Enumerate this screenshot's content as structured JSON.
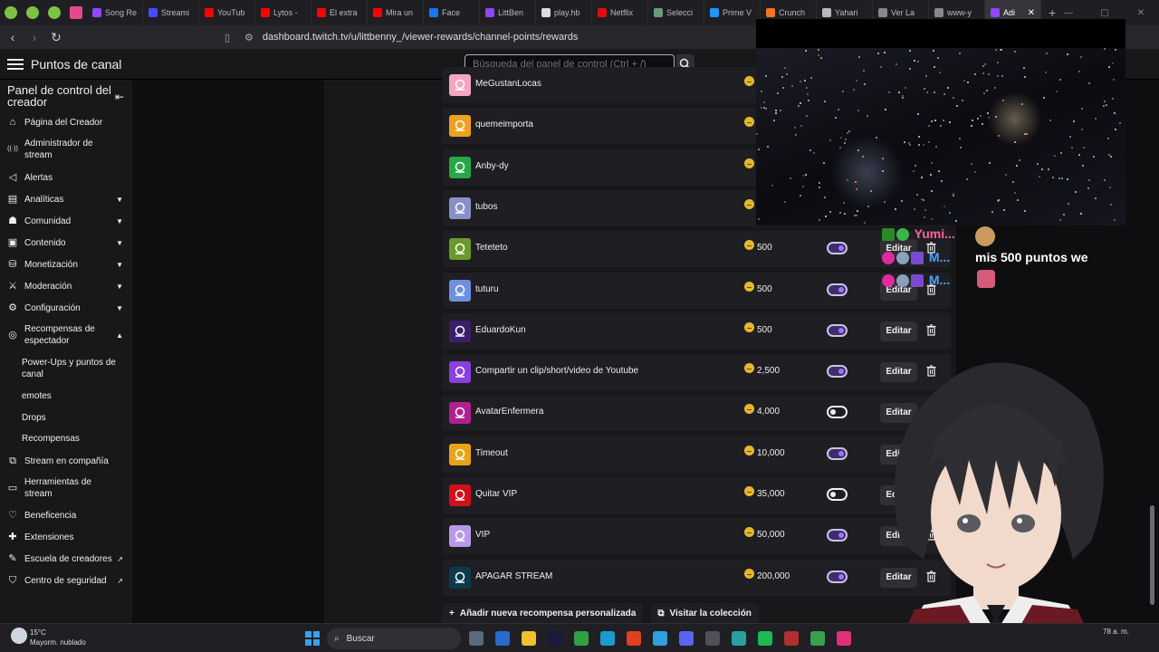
{
  "browser": {
    "tabs": [
      {
        "label": "Song Re",
        "color": "#9146ff"
      },
      {
        "label": "Streami",
        "color": "#4a4aff"
      },
      {
        "label": "YouTub",
        "color": "#ff0000"
      },
      {
        "label": "Lytos -",
        "color": "#ff0000"
      },
      {
        "label": "El extra",
        "color": "#ff0000"
      },
      {
        "label": "Mira un",
        "color": "#ff0000"
      },
      {
        "label": "Face",
        "color": "#1877f2"
      },
      {
        "label": "LittBen",
        "color": "#9146ff"
      },
      {
        "label": "play.hb",
        "color": "#dddddd"
      },
      {
        "label": "Netflix",
        "color": "#e50914"
      },
      {
        "label": "Selecci",
        "color": "#6a9a7a"
      },
      {
        "label": "Prime V",
        "color": "#1a98ff"
      },
      {
        "label": "Crunch",
        "color": "#f47521"
      },
      {
        "label": "Yahari",
        "color": "#bbbbbb"
      },
      {
        "label": "Ver La",
        "color": "#888888"
      },
      {
        "label": "www-y",
        "color": "#888888"
      },
      {
        "label": "Adi",
        "color": "#9146ff"
      }
    ],
    "new_tab": "+",
    "url": "dashboard.twitch.tv/u/littbenny_/viewer-rewards/channel-points/rewards"
  },
  "header": {
    "title": "Puntos de canal",
    "search_placeholder": "Búsqueda del panel de control (Ctrl + /)"
  },
  "sidebar": {
    "title": "Panel de control del creador",
    "items": [
      {
        "label": "Página del Creador",
        "icon": "home-icon"
      },
      {
        "label": "Administrador de stream",
        "icon": "broadcast-icon"
      },
      {
        "label": "Alertas",
        "icon": "megaphone-icon"
      },
      {
        "label": "Analíticas",
        "icon": "chart-icon"
      },
      {
        "label": "Comunidad",
        "icon": "people-icon"
      },
      {
        "label": "Contenido",
        "icon": "content-icon"
      },
      {
        "label": "Monetización",
        "icon": "money-icon"
      },
      {
        "label": "Moderación",
        "icon": "sword-icon"
      },
      {
        "label": "Configuración",
        "icon": "gear-icon"
      },
      {
        "label": "Recompensas de espectador",
        "icon": "reward-icon"
      },
      {
        "label": "Stream en compañía",
        "icon": "collab-icon"
      },
      {
        "label": "Herramientas de stream",
        "icon": "camera-icon"
      },
      {
        "label": "Beneficencia",
        "icon": "charity-icon"
      },
      {
        "label": "Extensiones",
        "icon": "puzzle-icon"
      },
      {
        "label": "Escuela de creadores",
        "icon": "school-icon"
      },
      {
        "label": "Centro de seguridad",
        "icon": "shield-icon"
      }
    ],
    "subitems": [
      "Power-Ups y puntos de canal",
      "emotes",
      "Drops",
      "Recompensas"
    ]
  },
  "rewards": [
    {
      "name": "MeGustanLocas",
      "cost": "",
      "color": "#f4a6c0",
      "enabled": true
    },
    {
      "name": "quemeimporta",
      "cost": "",
      "color": "#f0a020",
      "enabled": true
    },
    {
      "name": "Anby-dy",
      "cost": "",
      "color": "#28a745",
      "enabled": true
    },
    {
      "name": "tubos",
      "cost": "",
      "color": "#8b8fc9",
      "enabled": true
    },
    {
      "name": "Tetetetо",
      "cost": "500",
      "color": "#6b9a2a",
      "enabled": true
    },
    {
      "name": "tuturu",
      "cost": "500",
      "color": "#6f8fe0",
      "enabled": true
    },
    {
      "name": "EduardoKun",
      "cost": "500",
      "color": "#3b1f6b",
      "enabled": true
    },
    {
      "name": "Compartir un clip/short/video de Youtube",
      "cost": "2,500",
      "color": "#8a3fe0",
      "enabled": true
    },
    {
      "name": "AvatarEnfermera",
      "cost": "4,000",
      "color": "#b0208f",
      "enabled": false
    },
    {
      "name": "Timeout",
      "cost": "10,000",
      "color": "#e8a317",
      "enabled": true
    },
    {
      "name": "Quitar VIP",
      "cost": "35,000",
      "color": "#d0101a",
      "enabled": false
    },
    {
      "name": "VIP",
      "cost": "50,000",
      "color": "#b89ae8",
      "enabled": true
    },
    {
      "name": "APAGAR STREAM",
      "cost": "200,000",
      "color": "#0d3b4a",
      "enabled": true
    }
  ],
  "edit_label": "Editar",
  "actions": {
    "add": "Añadir nueva recompensa personalizada",
    "visit": "Visitar la colección"
  },
  "overlay_chat": {
    "user1": "Yumi...",
    "user2": "M...",
    "user3": "M...",
    "message": "mis 500 puntos we"
  },
  "taskbar": {
    "temp": "15°C",
    "weather": "Mayorm. nublado",
    "search": "Buscar",
    "clock": "78 a. m."
  }
}
